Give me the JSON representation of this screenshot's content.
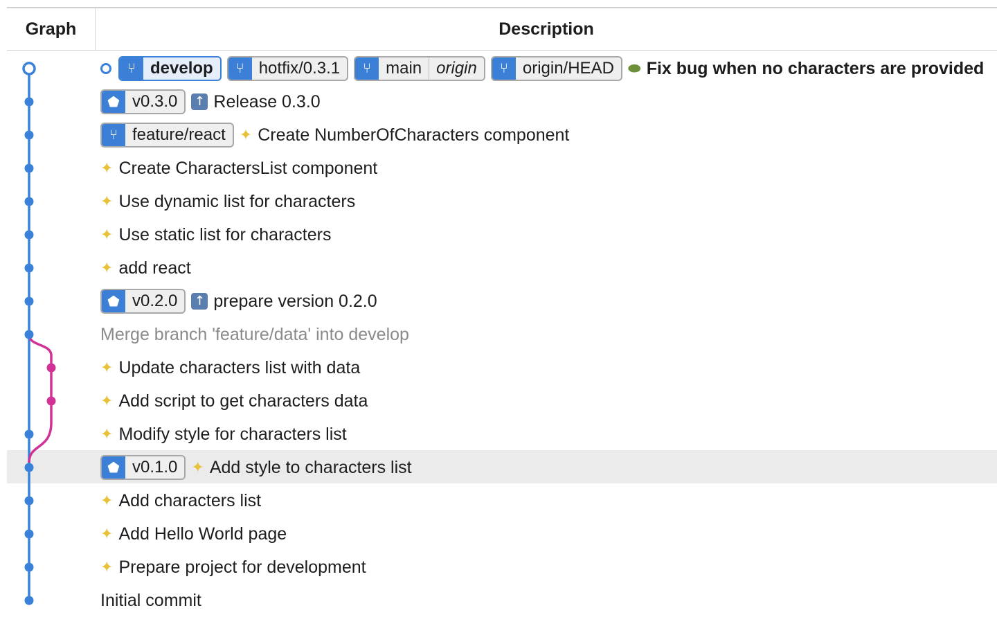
{
  "header": {
    "graph": "Graph",
    "description": "Description"
  },
  "colors": {
    "main_lane": "#3a82d9",
    "branch_lane": "#d03296",
    "branch_icon": "#3b7fd6",
    "selected_row": "#ebebeb"
  },
  "refs": {
    "develop": "develop",
    "hotfix": "hotfix/0.3.1",
    "main": "main",
    "main_remote": "origin",
    "origin_head": "origin/HEAD",
    "v030": "v0.3.0",
    "feature_react": "feature/react",
    "v020": "v0.2.0",
    "v010": "v0.1.0"
  },
  "commits": [
    {
      "message": "Fix bug when no characters are provided",
      "emoji": "pill-icon"
    },
    {
      "message": "Release 0.3.0",
      "emoji": "up-arrow-icon"
    },
    {
      "message": "Create NumberOfCharacters component",
      "emoji": "sparkles-icon"
    },
    {
      "message": "Create CharactersList component",
      "emoji": "sparkles-icon"
    },
    {
      "message": "Use dynamic list for characters",
      "emoji": "sparkles-icon"
    },
    {
      "message": "Use static list for characters",
      "emoji": "sparkles-icon"
    },
    {
      "message": "add react",
      "emoji": "sparkles-icon"
    },
    {
      "message": "prepare version 0.2.0",
      "emoji": "up-arrow-icon"
    },
    {
      "message": "Merge branch 'feature/data' into develop",
      "emoji": ""
    },
    {
      "message": "Update characters list with data",
      "emoji": "sparkles-icon"
    },
    {
      "message": "Add script to get characters data",
      "emoji": "sparkles-icon"
    },
    {
      "message": "Modify style for characters list",
      "emoji": "sparkles-icon"
    },
    {
      "message": "Add style to characters list",
      "emoji": "sparkles-icon"
    },
    {
      "message": "Add characters list",
      "emoji": "sparkles-icon"
    },
    {
      "message": "Add Hello World page",
      "emoji": "sparkles-icon"
    },
    {
      "message": "Prepare project for development",
      "emoji": "sparkles-icon"
    },
    {
      "message": "Initial commit",
      "emoji": ""
    }
  ]
}
